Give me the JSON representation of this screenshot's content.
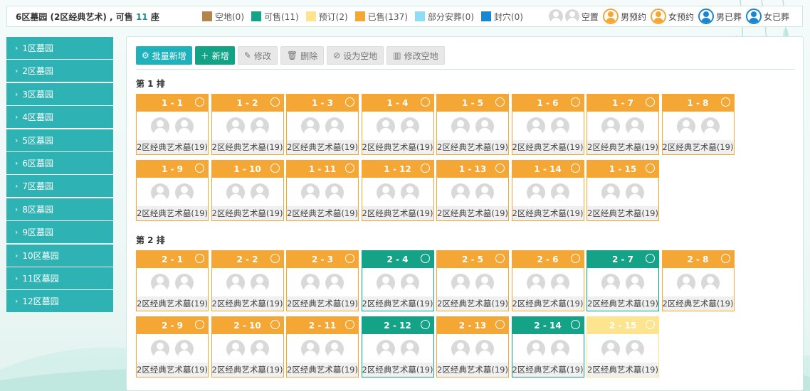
{
  "header": {
    "title_prefix": "6区墓园 (2区经典艺术) , 可售 ",
    "available_count": "11",
    "title_suffix": " 座"
  },
  "legend": [
    {
      "label": "空地(0)",
      "color": "#b5834e"
    },
    {
      "label": "可售(11)",
      "color": "#14a386"
    },
    {
      "label": "预订(2)",
      "color": "#fde58f"
    },
    {
      "label": "已售(137)",
      "color": "#f5a735"
    },
    {
      "label": "部分安葬(0)",
      "color": "#8fdcf6"
    },
    {
      "label": "封穴(0)",
      "color": "#1a86d0"
    }
  ],
  "avatar_legend": [
    {
      "label": "空置",
      "icon": "empty-avatar-icon"
    },
    {
      "label": "男预约",
      "icon": "male-reserved-icon",
      "color": "#f5a735"
    },
    {
      "label": "女预约",
      "icon": "female-reserved-icon",
      "color": "#f5a735"
    },
    {
      "label": "男已葬",
      "icon": "male-buried-icon",
      "color": "#1a86d0"
    },
    {
      "label": "女已葬",
      "icon": "female-buried-icon",
      "color": "#1a86d0"
    }
  ],
  "sidebar": {
    "items": [
      "1区墓园",
      "2区墓园",
      "3区墓园",
      "4区墓园",
      "5区墓园",
      "6区墓园",
      "7区墓园",
      "8区墓园",
      "9区墓园",
      "10区墓园",
      "11区墓园",
      "12区墓园"
    ]
  },
  "toolbar": {
    "batch_add": "批量新增",
    "add": "新增",
    "edit": "修改",
    "delete": "删除",
    "set_empty": "设为空地",
    "edit_empty": "修改空地"
  },
  "rows": [
    {
      "label": "第 1 排",
      "plots": [
        {
          "id": "1 - 1",
          "status": "sold",
          "name": "2区经典艺术墓(19)"
        },
        {
          "id": "1 - 2",
          "status": "sold",
          "name": "2区经典艺术墓(19)"
        },
        {
          "id": "1 - 3",
          "status": "sold",
          "name": "2区经典艺术墓(19)"
        },
        {
          "id": "1 - 4",
          "status": "sold",
          "name": "2区经典艺术墓(19)"
        },
        {
          "id": "1 - 5",
          "status": "sold",
          "name": "2区经典艺术墓(19)"
        },
        {
          "id": "1 - 6",
          "status": "sold",
          "name": "2区经典艺术墓(19)"
        },
        {
          "id": "1 - 7",
          "status": "sold",
          "name": "2区经典艺术墓(19)"
        },
        {
          "id": "1 - 8",
          "status": "sold",
          "name": "2区经典艺术墓(19)"
        },
        {
          "id": "1 - 9",
          "status": "sold",
          "name": "2区经典艺术墓(19)"
        },
        {
          "id": "1 - 10",
          "status": "sold",
          "name": "2区经典艺术墓(19)"
        },
        {
          "id": "1 - 11",
          "status": "sold",
          "name": "2区经典艺术墓(19)"
        },
        {
          "id": "1 - 12",
          "status": "sold",
          "name": "2区经典艺术墓(19)"
        },
        {
          "id": "1 - 13",
          "status": "sold",
          "name": "2区经典艺术墓(19)"
        },
        {
          "id": "1 - 14",
          "status": "sold",
          "name": "2区经典艺术墓(19)"
        },
        {
          "id": "1 - 15",
          "status": "sold",
          "name": "2区经典艺术墓(19)"
        }
      ]
    },
    {
      "label": "第 2 排",
      "plots": [
        {
          "id": "2 - 1",
          "status": "sold",
          "name": "2区经典艺术墓(19)"
        },
        {
          "id": "2 - 2",
          "status": "sold",
          "name": "2区经典艺术墓(19)"
        },
        {
          "id": "2 - 3",
          "status": "sold",
          "name": "2区经典艺术墓(19)"
        },
        {
          "id": "2 - 4",
          "status": "forsale",
          "name": "2区经典艺术墓(19)"
        },
        {
          "id": "2 - 5",
          "status": "sold",
          "name": "2区经典艺术墓(19)"
        },
        {
          "id": "2 - 6",
          "status": "sold",
          "name": "2区经典艺术墓(19)"
        },
        {
          "id": "2 - 7",
          "status": "forsale",
          "name": "2区经典艺术墓(19)"
        },
        {
          "id": "2 - 8",
          "status": "sold",
          "name": "2区经典艺术墓(19)"
        },
        {
          "id": "2 - 9",
          "status": "sold",
          "name": "2区经典艺术墓(19)"
        },
        {
          "id": "2 - 10",
          "status": "sold",
          "name": "2区经典艺术墓(19)"
        },
        {
          "id": "2 - 11",
          "status": "sold",
          "name": "2区经典艺术墓(19)"
        },
        {
          "id": "2 - 12",
          "status": "forsale",
          "name": "2区经典艺术墓(19)"
        },
        {
          "id": "2 - 13",
          "status": "sold",
          "name": "2区经典艺术墓(19)"
        },
        {
          "id": "2 - 14",
          "status": "forsale",
          "name": "2区经典艺术墓(19)"
        },
        {
          "id": "2 - 15",
          "status": "reserved",
          "name": "2区经典艺术墓(19)"
        }
      ]
    }
  ]
}
